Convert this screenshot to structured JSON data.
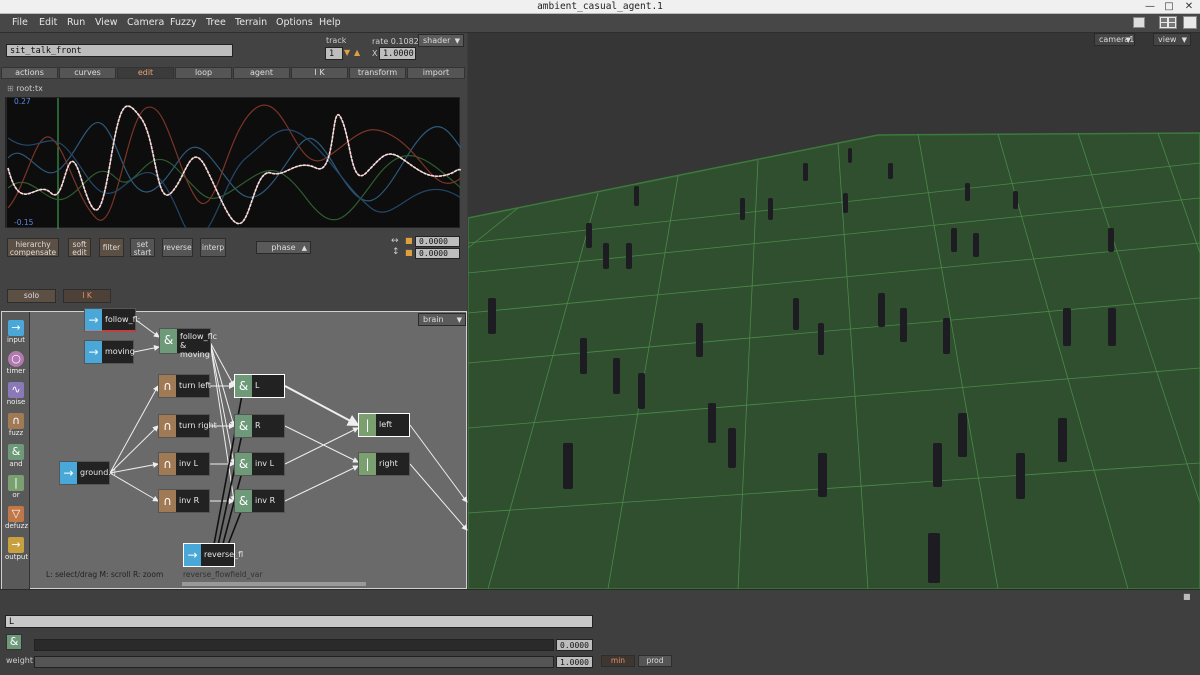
{
  "window": {
    "title": "ambient_casual_agent.1"
  },
  "menu": [
    "File",
    "Edit",
    "Run",
    "View",
    "Camera",
    "Fuzzy",
    "Tree",
    "Terrain",
    "Options",
    "Help"
  ],
  "action": {
    "name": "sit_talk_front",
    "track_label": "track",
    "track_value": "1",
    "rate_label": "rate",
    "rate_value": "0.1082",
    "x_label": "X",
    "x_value": "1.0000",
    "shader_label": "shader"
  },
  "tabs": [
    {
      "label": "actions",
      "active": false
    },
    {
      "label": "curves",
      "active": false
    },
    {
      "label": "edit",
      "active": true
    },
    {
      "label": "loop",
      "active": false
    },
    {
      "label": "agent",
      "active": false
    },
    {
      "label": "I K",
      "active": false
    },
    {
      "label": "transform",
      "active": false
    },
    {
      "label": "import",
      "active": false
    }
  ],
  "curve": {
    "channel": "root:tx",
    "max": "0.27",
    "min": "-0.15"
  },
  "curve_buttons": [
    "hierarchy compensate",
    "soft edit",
    "filter",
    "set start",
    "reverse",
    "interp"
  ],
  "phase_label": "phase",
  "offset_values": [
    "0.0000",
    "0.0000"
  ],
  "solo_label": "solo",
  "ik_label": "I K",
  "brain": {
    "dropdown": "brain",
    "status_hint": "L: select/drag   M: scroll   R: zoom",
    "selected_node_hint": "reverse_flowfield_var"
  },
  "palette": [
    {
      "label": "input",
      "icon": "arrow-icon",
      "color": "#4aa8d8"
    },
    {
      "label": "timer",
      "icon": "timer-icon",
      "color": "#b07ab0"
    },
    {
      "label": "noise",
      "icon": "noise-icon",
      "color": "#8a78b8"
    },
    {
      "label": "fuzz",
      "icon": "bell-curve-icon",
      "color": "#a07a55"
    },
    {
      "label": "and",
      "icon": "and-icon",
      "color": "#6e9a7a"
    },
    {
      "label": "or",
      "icon": "or-icon",
      "color": "#7aa070"
    },
    {
      "label": "defuzz",
      "icon": "triangle-down-icon",
      "color": "#c07848"
    },
    {
      "label": "output",
      "icon": "arrow-icon",
      "color": "#c8a040"
    }
  ],
  "nodes": [
    {
      "id": "follow",
      "label": "follow_fl:",
      "kind": "input"
    },
    {
      "id": "moving",
      "label": "moving",
      "kind": "input"
    },
    {
      "id": "follow_and",
      "label": "follow_flc & moving",
      "kind": "and"
    },
    {
      "id": "ground",
      "label": "ground.fl",
      "kind": "input"
    },
    {
      "id": "turn_left",
      "label": "turn left",
      "kind": "fuzz"
    },
    {
      "id": "turn_right",
      "label": "turn right",
      "kind": "fuzz"
    },
    {
      "id": "inv_l",
      "label": "inv L",
      "kind": "fuzz"
    },
    {
      "id": "inv_r",
      "label": "inv R",
      "kind": "fuzz"
    },
    {
      "id": "and_l",
      "label": "L",
      "kind": "and"
    },
    {
      "id": "and_r",
      "label": "R",
      "kind": "and"
    },
    {
      "id": "and_inv_l",
      "label": "inv L",
      "kind": "and"
    },
    {
      "id": "and_inv_r",
      "label": "inv R",
      "kind": "and"
    },
    {
      "id": "left",
      "label": "left",
      "kind": "or"
    },
    {
      "id": "right",
      "label": "right",
      "kind": "or"
    },
    {
      "id": "reverse",
      "label": "reverse_fl",
      "kind": "input"
    }
  ],
  "viewport": {
    "camera": "camera1",
    "view": "view"
  },
  "bottom": {
    "node_name": "L",
    "value": "0.0000",
    "weight_label": "weight",
    "weight_value": "1.0000",
    "min_label": "min",
    "prod_label": "prod"
  }
}
